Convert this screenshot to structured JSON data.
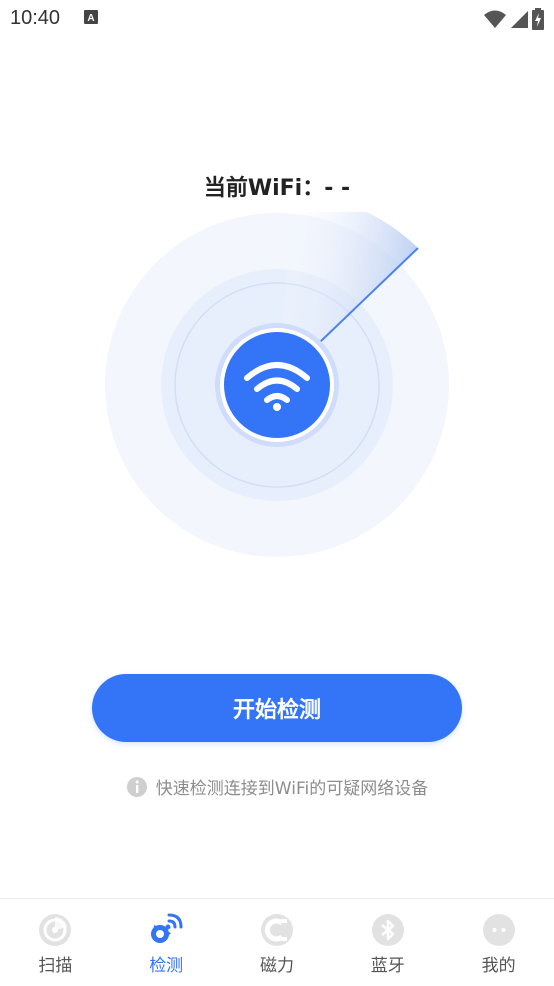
{
  "status_bar": {
    "time": "10:40",
    "app_icon_letter": "A"
  },
  "main": {
    "wifi_title": "当前WiFi：- -",
    "start_button": "开始检测",
    "hint": "快速检测连接到WiFi的可疑网络设备"
  },
  "tabs": [
    {
      "label": "扫描",
      "icon": "radar-scan-icon",
      "active": false
    },
    {
      "label": "检测",
      "icon": "satellite-dish-icon",
      "active": true
    },
    {
      "label": "磁力",
      "icon": "magnet-icon",
      "active": false
    },
    {
      "label": "蓝牙",
      "icon": "bluetooth-icon",
      "active": false
    },
    {
      "label": "我的",
      "icon": "profile-face-icon",
      "active": false
    }
  ],
  "colors": {
    "accent": "#3474f6",
    "inactive_icon": "#d6d6d6",
    "hint_text": "#8d8d8d"
  }
}
